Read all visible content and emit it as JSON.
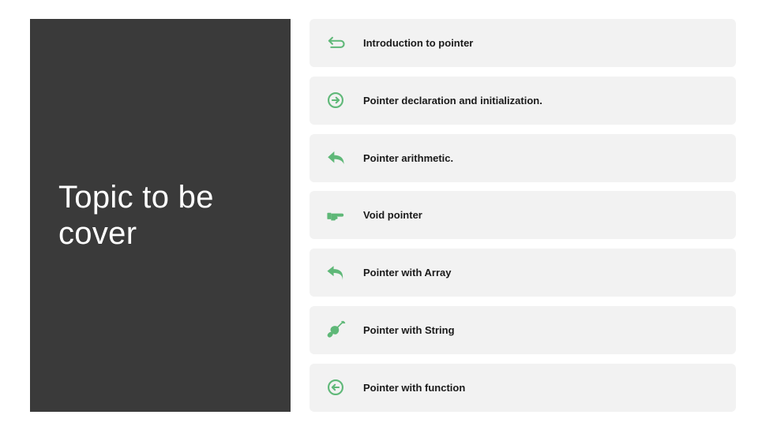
{
  "left": {
    "title": "Topic to be cover"
  },
  "colors": {
    "accent": "#5fb878",
    "panel": "#3a3a3a",
    "row_bg": "#f2f2f2"
  },
  "topics": [
    {
      "icon": "undo-outline-icon",
      "label": "Introduction to pointer"
    },
    {
      "icon": "circle-arrow-right-icon",
      "label": "Pointer declaration and initialization."
    },
    {
      "icon": "reply-solid-icon",
      "label": "Pointer arithmetic."
    },
    {
      "icon": "hand-point-right-icon",
      "label": "Void pointer"
    },
    {
      "icon": "undo-solid-icon",
      "label": "Pointer with Array"
    },
    {
      "icon": "violin-icon",
      "label": "Pointer with String"
    },
    {
      "icon": "circle-arrow-left-icon",
      "label": "Pointer with function"
    }
  ]
}
